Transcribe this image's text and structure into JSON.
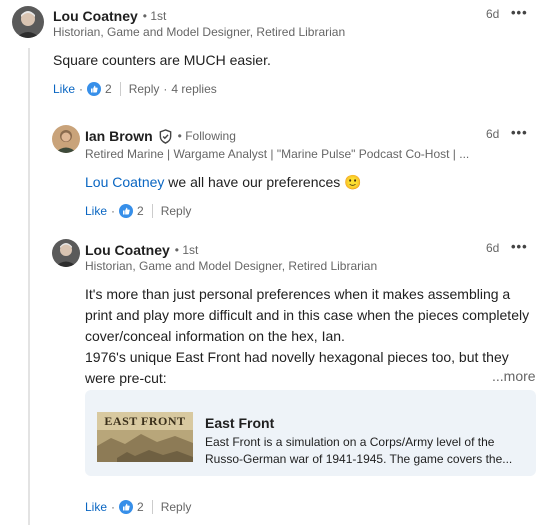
{
  "comments": {
    "first": {
      "author": "Lou Coatney",
      "degree": "• 1st",
      "headline": "Historian, Game and Model Designer, Retired Librarian",
      "time": "6d",
      "more": "•••",
      "text": "Square counters are MUCH easier.",
      "like_label": "Like",
      "dot": "·",
      "reaction_count": "2",
      "reply_label": "Reply",
      "replies_count": "4 replies"
    },
    "reply1": {
      "author": "Ian Brown",
      "following": "• Following",
      "headline": "Retired Marine | Wargame Analyst | \"Marine Pulse\" Podcast Co-Host | ...",
      "time": "6d",
      "more": "•••",
      "mention": "Lou Coatney",
      "text": " we all have our preferences 🙂",
      "like_label": "Like",
      "dot": "·",
      "reaction_count": "2",
      "reply_label": "Reply"
    },
    "reply2": {
      "author": "Lou Coatney",
      "degree": "• 1st",
      "headline": "Historian, Game and Model Designer, Retired Librarian",
      "time": "6d",
      "more": "•••",
      "line1": "It's more than just personal preferences when it makes assembling a",
      "line2": "print and play more difficult and in this case when the pieces completely",
      "line3": "cover/conceal information on the hex, Ian.",
      "line4": "1976's unique East Front had novelly hexagonal pieces too, but they",
      "line5": "were pre-cut:",
      "see_more": "...more",
      "card": {
        "thumb_text": "EAST FRONT",
        "title": "East Front",
        "desc_line1": "East Front is a simulation on a Corps/Army level of the",
        "desc_line2": "Russo-German war of 1941-1945. The game covers the..."
      },
      "like_label": "Like",
      "dot": "·",
      "reaction_count": "2",
      "reply_label": "Reply"
    }
  },
  "colors": {
    "link_blue": "#0a66c2",
    "muted": "#666666",
    "card_bg": "#eef3f8"
  }
}
